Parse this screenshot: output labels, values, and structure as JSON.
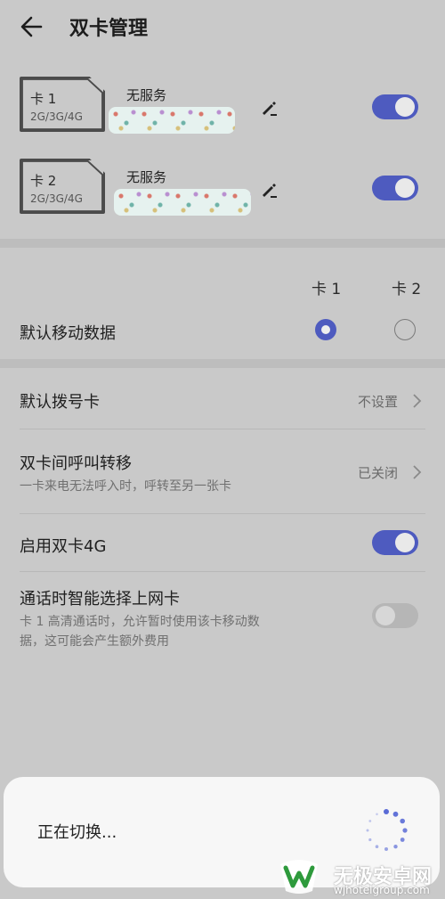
{
  "header": {
    "title": "双卡管理"
  },
  "sims": [
    {
      "name": "卡 1",
      "network": "2G/3G/4G",
      "service": "无服务",
      "enabled": true
    },
    {
      "name": "卡 2",
      "network": "2G/3G/4G",
      "service": "无服务",
      "enabled": true
    }
  ],
  "mobile_data": {
    "label": "默认移动数据",
    "col1": "卡 1",
    "col2": "卡 2",
    "selected": "卡 1"
  },
  "settings": {
    "default_dial": {
      "label": "默认拨号卡",
      "value": "不设置"
    },
    "call_forward": {
      "label": "双卡间呼叫转移",
      "desc": "一卡来电无法呼入时，呼转至另一张卡",
      "value": "已关闭"
    },
    "dual_4g": {
      "label": "启用双卡4G",
      "enabled": true
    },
    "smart_select": {
      "label": "通话时智能选择上网卡",
      "desc_line1": "卡 1 高清通话时，允许暂时使用该卡移动数",
      "desc_line2": "据，这可能会产生额外费用",
      "enabled": false
    }
  },
  "dialog": {
    "text": "正在切换..."
  },
  "watermark": {
    "title": "无极安卓网",
    "url": "wjhotelgroup.com"
  },
  "colors": {
    "accent": "#4e5bbf",
    "background": "#c9c9c9"
  }
}
